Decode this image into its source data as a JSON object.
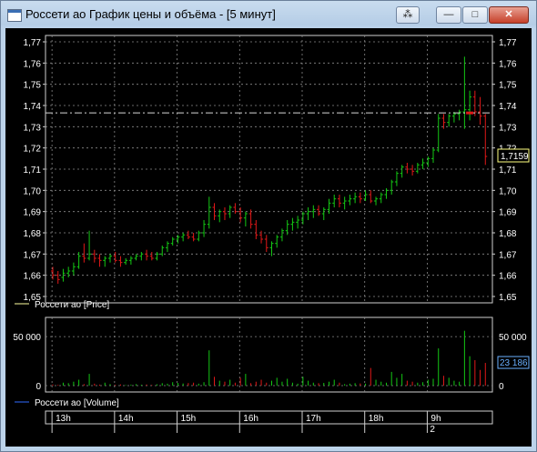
{
  "window": {
    "title": "Россети ао График цены и объёма - [5 минут]",
    "buttons": {
      "special": "⁂",
      "minimize": "—",
      "maximize": "□",
      "close": "✕"
    }
  },
  "colors": {
    "up": "#14c814",
    "down": "#e01818",
    "grid": "#8a8a8a",
    "text": "#ffffff",
    "current": "#ffff80",
    "volume_label": "#6ab0ff"
  },
  "chart_data": [
    {
      "type": "candlestick",
      "legend": "Россети ао [Price]",
      "ylim": [
        1.65,
        1.77
      ],
      "yticks": [
        "1,65",
        "1,66",
        "1,67",
        "1,68",
        "1,69",
        "1,70",
        "1,71",
        "1,72",
        "1,73",
        "1,74",
        "1,75",
        "1,76",
        "1,77"
      ],
      "current_price": 1.7365,
      "current_label": "1,7159",
      "ohlc": [
        [
          1.662,
          1.664,
          1.658,
          1.66
        ],
        [
          1.66,
          1.662,
          1.656,
          1.658
        ],
        [
          1.659,
          1.663,
          1.657,
          1.661
        ],
        [
          1.661,
          1.664,
          1.659,
          1.662
        ],
        [
          1.662,
          1.666,
          1.66,
          1.664
        ],
        [
          1.664,
          1.671,
          1.663,
          1.669
        ],
        [
          1.669,
          1.675,
          1.666,
          1.668
        ],
        [
          1.668,
          1.681,
          1.667,
          1.67
        ],
        [
          1.67,
          1.672,
          1.666,
          1.668
        ],
        [
          1.668,
          1.67,
          1.664,
          1.667
        ],
        [
          1.667,
          1.669,
          1.664,
          1.668
        ],
        [
          1.668,
          1.67,
          1.666,
          1.669
        ],
        [
          1.669,
          1.671,
          1.666,
          1.667
        ],
        [
          1.667,
          1.669,
          1.664,
          1.666
        ],
        [
          1.666,
          1.668,
          1.665,
          1.667
        ],
        [
          1.667,
          1.669,
          1.665,
          1.668
        ],
        [
          1.668,
          1.67,
          1.667,
          1.669
        ],
        [
          1.669,
          1.671,
          1.667,
          1.67
        ],
        [
          1.67,
          1.672,
          1.667,
          1.669
        ],
        [
          1.669,
          1.671,
          1.667,
          1.668
        ],
        [
          1.668,
          1.671,
          1.667,
          1.67
        ],
        [
          1.67,
          1.674,
          1.669,
          1.673
        ],
        [
          1.673,
          1.676,
          1.671,
          1.675
        ],
        [
          1.675,
          1.678,
          1.674,
          1.677
        ],
        [
          1.677,
          1.679,
          1.675,
          1.678
        ],
        [
          1.678,
          1.68,
          1.676,
          1.679
        ],
        [
          1.679,
          1.681,
          1.677,
          1.678
        ],
        [
          1.678,
          1.68,
          1.676,
          1.677
        ],
        [
          1.677,
          1.681,
          1.676,
          1.68
        ],
        [
          1.68,
          1.686,
          1.678,
          1.684
        ],
        [
          1.684,
          1.697,
          1.682,
          1.692
        ],
        [
          1.692,
          1.694,
          1.686,
          1.688
        ],
        [
          1.688,
          1.691,
          1.685,
          1.69
        ],
        [
          1.69,
          1.692,
          1.686,
          1.689
        ],
        [
          1.689,
          1.693,
          1.687,
          1.692
        ],
        [
          1.692,
          1.694,
          1.689,
          1.69
        ],
        [
          1.69,
          1.692,
          1.685,
          1.687
        ],
        [
          1.687,
          1.69,
          1.683,
          1.689
        ],
        [
          1.689,
          1.691,
          1.682,
          1.684
        ],
        [
          1.684,
          1.686,
          1.677,
          1.679
        ],
        [
          1.679,
          1.681,
          1.675,
          1.677
        ],
        [
          1.677,
          1.679,
          1.671,
          1.673
        ],
        [
          1.673,
          1.676,
          1.669,
          1.675
        ],
        [
          1.675,
          1.679,
          1.673,
          1.678
        ],
        [
          1.678,
          1.682,
          1.676,
          1.681
        ],
        [
          1.681,
          1.686,
          1.679,
          1.684
        ],
        [
          1.684,
          1.687,
          1.681,
          1.685
        ],
        [
          1.685,
          1.688,
          1.682,
          1.686
        ],
        [
          1.686,
          1.69,
          1.684,
          1.689
        ],
        [
          1.689,
          1.692,
          1.686,
          1.69
        ],
        [
          1.69,
          1.693,
          1.687,
          1.691
        ],
        [
          1.691,
          1.693,
          1.688,
          1.689
        ],
        [
          1.689,
          1.692,
          1.686,
          1.691
        ],
        [
          1.691,
          1.696,
          1.689,
          1.694
        ],
        [
          1.694,
          1.698,
          1.692,
          1.696
        ],
        [
          1.696,
          1.698,
          1.692,
          1.694
        ],
        [
          1.694,
          1.697,
          1.691,
          1.695
        ],
        [
          1.695,
          1.698,
          1.693,
          1.696
        ],
        [
          1.696,
          1.699,
          1.694,
          1.697
        ],
        [
          1.697,
          1.699,
          1.694,
          1.696
        ],
        [
          1.696,
          1.7,
          1.695,
          1.698
        ],
        [
          1.698,
          1.7,
          1.694,
          1.695
        ],
        [
          1.695,
          1.697,
          1.693,
          1.696
        ],
        [
          1.696,
          1.699,
          1.694,
          1.698
        ],
        [
          1.698,
          1.701,
          1.696,
          1.7
        ],
        [
          1.7,
          1.705,
          1.698,
          1.704
        ],
        [
          1.704,
          1.709,
          1.702,
          1.708
        ],
        [
          1.708,
          1.712,
          1.706,
          1.711
        ],
        [
          1.711,
          1.713,
          1.708,
          1.71
        ],
        [
          1.71,
          1.712,
          1.707,
          1.709
        ],
        [
          1.709,
          1.713,
          1.708,
          1.712
        ],
        [
          1.712,
          1.715,
          1.71,
          1.713
        ],
        [
          1.713,
          1.716,
          1.711,
          1.715
        ],
        [
          1.715,
          1.72,
          1.713,
          1.719
        ],
        [
          1.719,
          1.736,
          1.718,
          1.734
        ],
        [
          1.734,
          1.736,
          1.729,
          1.732
        ],
        [
          1.732,
          1.736,
          1.73,
          1.735
        ],
        [
          1.735,
          1.737,
          1.732,
          1.736
        ],
        [
          1.736,
          1.738,
          1.733,
          1.737
        ],
        [
          1.737,
          1.763,
          1.729,
          1.738
        ],
        [
          1.738,
          1.747,
          1.733,
          1.744
        ],
        [
          1.744,
          1.747,
          1.735,
          1.737
        ],
        [
          1.737,
          1.744,
          1.731,
          1.735
        ],
        [
          1.735,
          1.736,
          1.712,
          1.716
        ]
      ]
    },
    {
      "type": "bar",
      "legend": "Россети ао [Volume]",
      "ylim": [
        0,
        65000
      ],
      "yticks": [
        "0",
        "50 000"
      ],
      "current_label": "23 186",
      "values": [
        1200,
        800,
        3000,
        2500,
        4000,
        6000,
        1500,
        12000,
        2000,
        1000,
        3000,
        1500,
        800,
        1200,
        600,
        1000,
        1500,
        900,
        1100,
        700,
        1300,
        2500,
        2000,
        3500,
        2800,
        2200,
        2600,
        3000,
        2000,
        3500,
        36000,
        9000,
        5000,
        4000,
        6000,
        3000,
        8000,
        12000,
        2500,
        4000,
        6000,
        3000,
        5000,
        8000,
        4000,
        7000,
        3000,
        2000,
        9000,
        5000,
        3000,
        2500,
        2800,
        4000,
        6000,
        3000,
        1500,
        2000,
        2500,
        2200,
        2000,
        18000,
        6000,
        4000,
        3000,
        14000,
        8000,
        12000,
        5000,
        4000,
        3000,
        3500,
        6000,
        7000,
        38000,
        10000,
        8000,
        5000,
        4000,
        56000,
        30000,
        26000,
        16000,
        23186
      ]
    }
  ],
  "time_axis": {
    "labels": [
      "13h",
      "14h",
      "15h",
      "16h",
      "17h",
      "18h",
      "9h"
    ],
    "day_label": "2"
  }
}
